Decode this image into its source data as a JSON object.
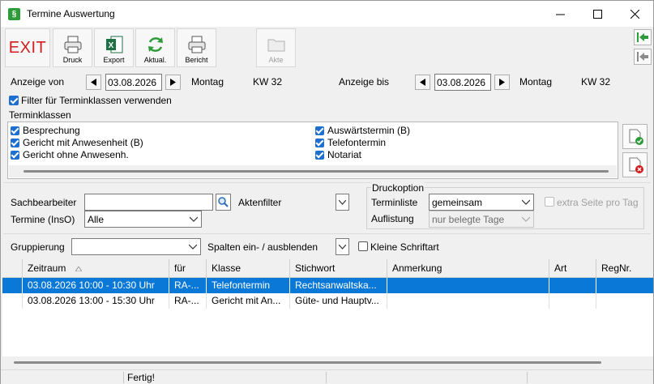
{
  "window": {
    "title": "Termine Auswertung"
  },
  "toolbar": {
    "exit_label": "EXIT",
    "buttons": [
      {
        "label": "Druck",
        "icon": "printer-icon"
      },
      {
        "label": "Export",
        "icon": "excel-icon"
      },
      {
        "label": "Aktual.",
        "icon": "refresh-icon"
      },
      {
        "label": "Bericht",
        "icon": "report-printer-icon"
      },
      {
        "label": "Akte",
        "icon": "folder-icon"
      }
    ]
  },
  "range": {
    "from_label": "Anzeige von",
    "from_date": "03.08.2026",
    "from_weekday": "Montag",
    "from_week": "KW 32",
    "to_label": "Anzeige bis",
    "to_date": "03.08.2026",
    "to_weekday": "Montag",
    "to_week": "KW 32"
  },
  "filter": {
    "label": "Filter für Terminklassen verwenden",
    "checked": true
  },
  "terminklassen": {
    "title": "Terminklassen",
    "items_left": [
      "Besprechung",
      "Gericht mit Anwesenheit (B)",
      "Gericht ohne Anwesenh."
    ],
    "items_right": [
      "Auswärtstermin (B)",
      "Telefontermin",
      "Notariat"
    ]
  },
  "form": {
    "sachbearbeiter_label": "Sachbearbeiter",
    "sachbearbeiter_value": "",
    "aktenfilter_label": "Aktenfilter",
    "termine_label": "Termine (InsO)",
    "termine_value": "Alle",
    "gruppierung_label": "Gruppierung",
    "gruppierung_value": "",
    "spalten_label": "Spalten ein- / ausblenden",
    "kleine_label": "Kleine Schriftart"
  },
  "druckoption": {
    "title": "Druckoption",
    "terminliste_label": "Terminliste",
    "terminliste_value": "gemeinsam",
    "auflistung_label": "Auflistung",
    "auflistung_value": "nur belegte Tage",
    "extra_label": "extra Seite pro Tag"
  },
  "table": {
    "columns": [
      "Zeitraum",
      "für",
      "Klasse",
      "Stichwort",
      "Anmerkung",
      "Art",
      "RegNr."
    ],
    "rows": [
      [
        "03.08.2026 10:00 - 10:30 Uhr",
        "RA-...",
        "Telefontermin",
        "Rechtsanwaltska...",
        "",
        "",
        ""
      ],
      [
        "03.08.2026 13:00 - 15:30 Uhr",
        "RA-...",
        "Gericht mit An...",
        "Güte- und Hauptv...",
        "",
        "",
        ""
      ]
    ]
  },
  "status": {
    "text": "Fertig!"
  }
}
